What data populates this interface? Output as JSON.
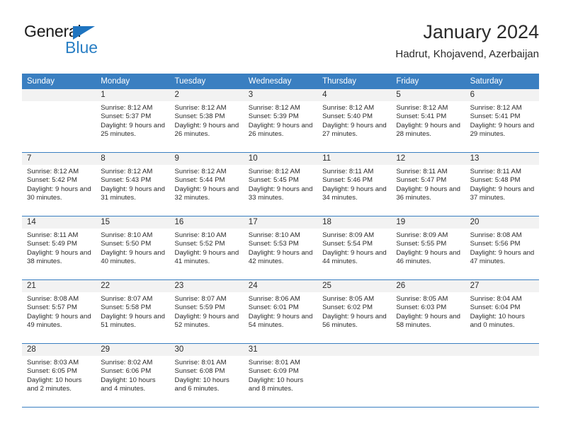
{
  "brand": {
    "name_dark": "General",
    "name_light": "Blue",
    "triangle_color": "#1e74c0",
    "blue_color": "#2a7fc4"
  },
  "header": {
    "title": "January 2024",
    "subtitle": "Hadrut, Khojavend, Azerbaijan",
    "header_bg": "#3a7fc1",
    "band_bg": "#f2f2f2"
  },
  "weekdays": [
    "Sunday",
    "Monday",
    "Tuesday",
    "Wednesday",
    "Thursday",
    "Friday",
    "Saturday"
  ],
  "labels": {
    "sunrise_prefix": "Sunrise:",
    "sunset_prefix": "Sunset:",
    "daylight_prefix": "Daylight:"
  },
  "weeks": [
    [
      {
        "day": "",
        "sunrise": "",
        "sunset": "",
        "daylight": ""
      },
      {
        "day": "1",
        "sunrise": "Sunrise: 8:12 AM",
        "sunset": "Sunset: 5:37 PM",
        "daylight": "Daylight: 9 hours and 25 minutes."
      },
      {
        "day": "2",
        "sunrise": "Sunrise: 8:12 AM",
        "sunset": "Sunset: 5:38 PM",
        "daylight": "Daylight: 9 hours and 26 minutes."
      },
      {
        "day": "3",
        "sunrise": "Sunrise: 8:12 AM",
        "sunset": "Sunset: 5:39 PM",
        "daylight": "Daylight: 9 hours and 26 minutes."
      },
      {
        "day": "4",
        "sunrise": "Sunrise: 8:12 AM",
        "sunset": "Sunset: 5:40 PM",
        "daylight": "Daylight: 9 hours and 27 minutes."
      },
      {
        "day": "5",
        "sunrise": "Sunrise: 8:12 AM",
        "sunset": "Sunset: 5:41 PM",
        "daylight": "Daylight: 9 hours and 28 minutes."
      },
      {
        "day": "6",
        "sunrise": "Sunrise: 8:12 AM",
        "sunset": "Sunset: 5:41 PM",
        "daylight": "Daylight: 9 hours and 29 minutes."
      }
    ],
    [
      {
        "day": "7",
        "sunrise": "Sunrise: 8:12 AM",
        "sunset": "Sunset: 5:42 PM",
        "daylight": "Daylight: 9 hours and 30 minutes."
      },
      {
        "day": "8",
        "sunrise": "Sunrise: 8:12 AM",
        "sunset": "Sunset: 5:43 PM",
        "daylight": "Daylight: 9 hours and 31 minutes."
      },
      {
        "day": "9",
        "sunrise": "Sunrise: 8:12 AM",
        "sunset": "Sunset: 5:44 PM",
        "daylight": "Daylight: 9 hours and 32 minutes."
      },
      {
        "day": "10",
        "sunrise": "Sunrise: 8:12 AM",
        "sunset": "Sunset: 5:45 PM",
        "daylight": "Daylight: 9 hours and 33 minutes."
      },
      {
        "day": "11",
        "sunrise": "Sunrise: 8:11 AM",
        "sunset": "Sunset: 5:46 PM",
        "daylight": "Daylight: 9 hours and 34 minutes."
      },
      {
        "day": "12",
        "sunrise": "Sunrise: 8:11 AM",
        "sunset": "Sunset: 5:47 PM",
        "daylight": "Daylight: 9 hours and 36 minutes."
      },
      {
        "day": "13",
        "sunrise": "Sunrise: 8:11 AM",
        "sunset": "Sunset: 5:48 PM",
        "daylight": "Daylight: 9 hours and 37 minutes."
      }
    ],
    [
      {
        "day": "14",
        "sunrise": "Sunrise: 8:11 AM",
        "sunset": "Sunset: 5:49 PM",
        "daylight": "Daylight: 9 hours and 38 minutes."
      },
      {
        "day": "15",
        "sunrise": "Sunrise: 8:10 AM",
        "sunset": "Sunset: 5:50 PM",
        "daylight": "Daylight: 9 hours and 40 minutes."
      },
      {
        "day": "16",
        "sunrise": "Sunrise: 8:10 AM",
        "sunset": "Sunset: 5:52 PM",
        "daylight": "Daylight: 9 hours and 41 minutes."
      },
      {
        "day": "17",
        "sunrise": "Sunrise: 8:10 AM",
        "sunset": "Sunset: 5:53 PM",
        "daylight": "Daylight: 9 hours and 42 minutes."
      },
      {
        "day": "18",
        "sunrise": "Sunrise: 8:09 AM",
        "sunset": "Sunset: 5:54 PM",
        "daylight": "Daylight: 9 hours and 44 minutes."
      },
      {
        "day": "19",
        "sunrise": "Sunrise: 8:09 AM",
        "sunset": "Sunset: 5:55 PM",
        "daylight": "Daylight: 9 hours and 46 minutes."
      },
      {
        "day": "20",
        "sunrise": "Sunrise: 8:08 AM",
        "sunset": "Sunset: 5:56 PM",
        "daylight": "Daylight: 9 hours and 47 minutes."
      }
    ],
    [
      {
        "day": "21",
        "sunrise": "Sunrise: 8:08 AM",
        "sunset": "Sunset: 5:57 PM",
        "daylight": "Daylight: 9 hours and 49 minutes."
      },
      {
        "day": "22",
        "sunrise": "Sunrise: 8:07 AM",
        "sunset": "Sunset: 5:58 PM",
        "daylight": "Daylight: 9 hours and 51 minutes."
      },
      {
        "day": "23",
        "sunrise": "Sunrise: 8:07 AM",
        "sunset": "Sunset: 5:59 PM",
        "daylight": "Daylight: 9 hours and 52 minutes."
      },
      {
        "day": "24",
        "sunrise": "Sunrise: 8:06 AM",
        "sunset": "Sunset: 6:01 PM",
        "daylight": "Daylight: 9 hours and 54 minutes."
      },
      {
        "day": "25",
        "sunrise": "Sunrise: 8:05 AM",
        "sunset": "Sunset: 6:02 PM",
        "daylight": "Daylight: 9 hours and 56 minutes."
      },
      {
        "day": "26",
        "sunrise": "Sunrise: 8:05 AM",
        "sunset": "Sunset: 6:03 PM",
        "daylight": "Daylight: 9 hours and 58 minutes."
      },
      {
        "day": "27",
        "sunrise": "Sunrise: 8:04 AM",
        "sunset": "Sunset: 6:04 PM",
        "daylight": "Daylight: 10 hours and 0 minutes."
      }
    ],
    [
      {
        "day": "28",
        "sunrise": "Sunrise: 8:03 AM",
        "sunset": "Sunset: 6:05 PM",
        "daylight": "Daylight: 10 hours and 2 minutes."
      },
      {
        "day": "29",
        "sunrise": "Sunrise: 8:02 AM",
        "sunset": "Sunset: 6:06 PM",
        "daylight": "Daylight: 10 hours and 4 minutes."
      },
      {
        "day": "30",
        "sunrise": "Sunrise: 8:01 AM",
        "sunset": "Sunset: 6:08 PM",
        "daylight": "Daylight: 10 hours and 6 minutes."
      },
      {
        "day": "31",
        "sunrise": "Sunrise: 8:01 AM",
        "sunset": "Sunset: 6:09 PM",
        "daylight": "Daylight: 10 hours and 8 minutes."
      },
      {
        "day": "",
        "sunrise": "",
        "sunset": "",
        "daylight": ""
      },
      {
        "day": "",
        "sunrise": "",
        "sunset": "",
        "daylight": ""
      },
      {
        "day": "",
        "sunrise": "",
        "sunset": "",
        "daylight": ""
      }
    ]
  ]
}
